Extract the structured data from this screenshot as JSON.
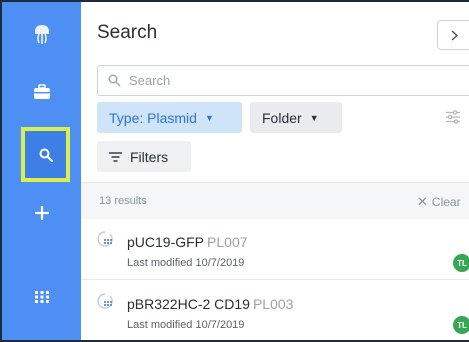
{
  "rail": {
    "items": [
      {
        "name": "logo",
        "icon": "jellyfish-logo-icon"
      },
      {
        "name": "inventory",
        "icon": "briefcase-icon"
      },
      {
        "name": "search",
        "icon": "search-icon",
        "active": true
      },
      {
        "name": "create",
        "icon": "plus-icon"
      },
      {
        "name": "apps",
        "icon": "grid-icon"
      }
    ],
    "background": "#4d8ff2",
    "highlight": "#d8ef4d"
  },
  "panel": {
    "title": "Search",
    "collapse_icon": "chevron-right-icon"
  },
  "search": {
    "placeholder": "Search",
    "value": ""
  },
  "filters": {
    "type_label": "Type: Plasmid",
    "folder_label": "Folder",
    "filters_label": "Filters"
  },
  "results": {
    "count_label": "13 results",
    "clear_label": "Clear",
    "items": [
      {
        "name": "pUC19-GFP",
        "code": "PL007",
        "modified": "Last modified 10/7/2019",
        "owner_initials": "TL"
      },
      {
        "name": "pBR322HC-2 CD19",
        "code": "PL003",
        "modified": "Last modified 10/7/2019",
        "owner_initials": "TL"
      }
    ]
  },
  "colors": {
    "accent": "#2f75d8",
    "pill_active_bg": "#cfe4f8",
    "avatar": "#36a853"
  }
}
